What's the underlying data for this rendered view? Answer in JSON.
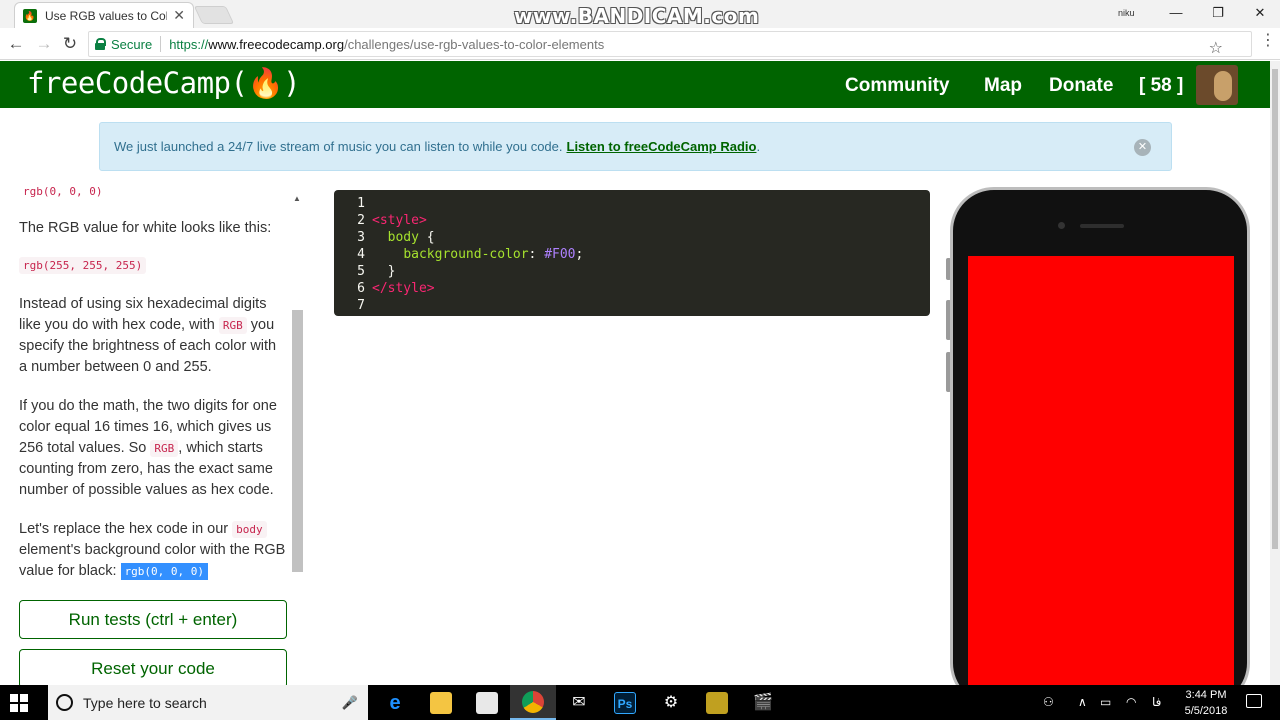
{
  "browser": {
    "tab_title": "Use RGB values to Color E",
    "tab_close": "✕",
    "favicon": "(🔥)",
    "watermark": "www.BANDICAM.com",
    "profile_name": "niku",
    "window_minimize": "—",
    "window_maximize": "❐",
    "window_close": "✕",
    "back_icon": "←",
    "forward_icon": "→",
    "reload_icon": "↻",
    "secure_label": "Secure",
    "url_scheme": "https://",
    "url_host": "www.freecodecamp.org",
    "url_path": "/challenges/use-rgb-values-to-color-elements",
    "bookmark_icon": "☆",
    "menu_icon": "⋮"
  },
  "nav": {
    "logo": "freeCodeCamp(🔥)",
    "links": [
      "Community",
      "Map",
      "Donate"
    ],
    "points": "[ 58 ]"
  },
  "banner": {
    "text": "We just launched a 24/7 live stream of music you can listen to while you code.",
    "link": "Listen to freeCodeCamp Radio",
    "suffix": ".",
    "close": "✕"
  },
  "instructions": {
    "cut_code": "rgb(0, 0, 0)",
    "p1": "The RGB value for white looks like this:",
    "code_white": "rgb(255, 255, 255)",
    "p2_a": "Instead of using six hexadecimal digits like you do with hex code, with",
    "p2_code": "RGB",
    "p2_b": "you specify the brightness of each color with a number between 0 and 255.",
    "p3_a": "If you do the math, the two digits for one color equal 16 times 16, which gives us 256 total values. So",
    "p3_code": "RGB",
    "p3_b": ", which starts counting from zero, has the exact same number of possible values as hex code.",
    "p4_a": "Let's replace the hex code in our",
    "p4_code": "body",
    "p4_b": "element's background color with the RGB value for black:",
    "p4_code2": "rgb(0, 0, 0)",
    "run_button": "Run tests (ctrl + enter)",
    "reset_button": "Reset your code"
  },
  "editor": {
    "lines": [
      {
        "n": "1",
        "t": ""
      },
      {
        "n": "2",
        "t": "<style>"
      },
      {
        "n": "3",
        "t": "body {"
      },
      {
        "n": "4",
        "t": "background-color: #F00;"
      },
      {
        "n": "5",
        "t": "}"
      },
      {
        "n": "6",
        "t": "</style>"
      },
      {
        "n": "7",
        "t": ""
      }
    ],
    "tokens": {
      "open_tag": "<style>",
      "selector": "body",
      "brace_open": " {",
      "property": "background-color",
      "colon": ": ",
      "value": "#F00",
      "semicolon": ";",
      "brace_close": "}",
      "close_tag": "</style>"
    }
  },
  "preview": {
    "background_color": "#ff0000"
  },
  "taskbar": {
    "search_placeholder": "Type here to search",
    "mic_icon": "🎤",
    "apps": [
      {
        "name": "edge-icon",
        "glyph": "e",
        "color": "#1e90ff"
      },
      {
        "name": "file-explorer-icon",
        "glyph": "",
        "color": "#f4c542"
      },
      {
        "name": "store-icon",
        "glyph": "",
        "color": "#e8e8e8"
      },
      {
        "name": "chrome-icon",
        "glyph": "",
        "color": "#db4437"
      },
      {
        "name": "mail-icon",
        "glyph": "✉",
        "color": "#ffffff"
      },
      {
        "name": "photoshop-icon",
        "glyph": "Ps",
        "color": "#001e36"
      },
      {
        "name": "settings-icon",
        "glyph": "⚙",
        "color": "#ffffff"
      },
      {
        "name": "sticky-app-icon",
        "glyph": "",
        "color": "#c0a020"
      },
      {
        "name": "video-editor-icon",
        "glyph": "🎬",
        "color": "#ffffff"
      }
    ],
    "tray_people": "⚇",
    "tray_chevron": "∧",
    "tray_battery": "▭",
    "tray_wifi": "◠",
    "tray_volume": "◁",
    "lang": "فا",
    "time": "3:44 PM",
    "date": "5/5/2018"
  }
}
